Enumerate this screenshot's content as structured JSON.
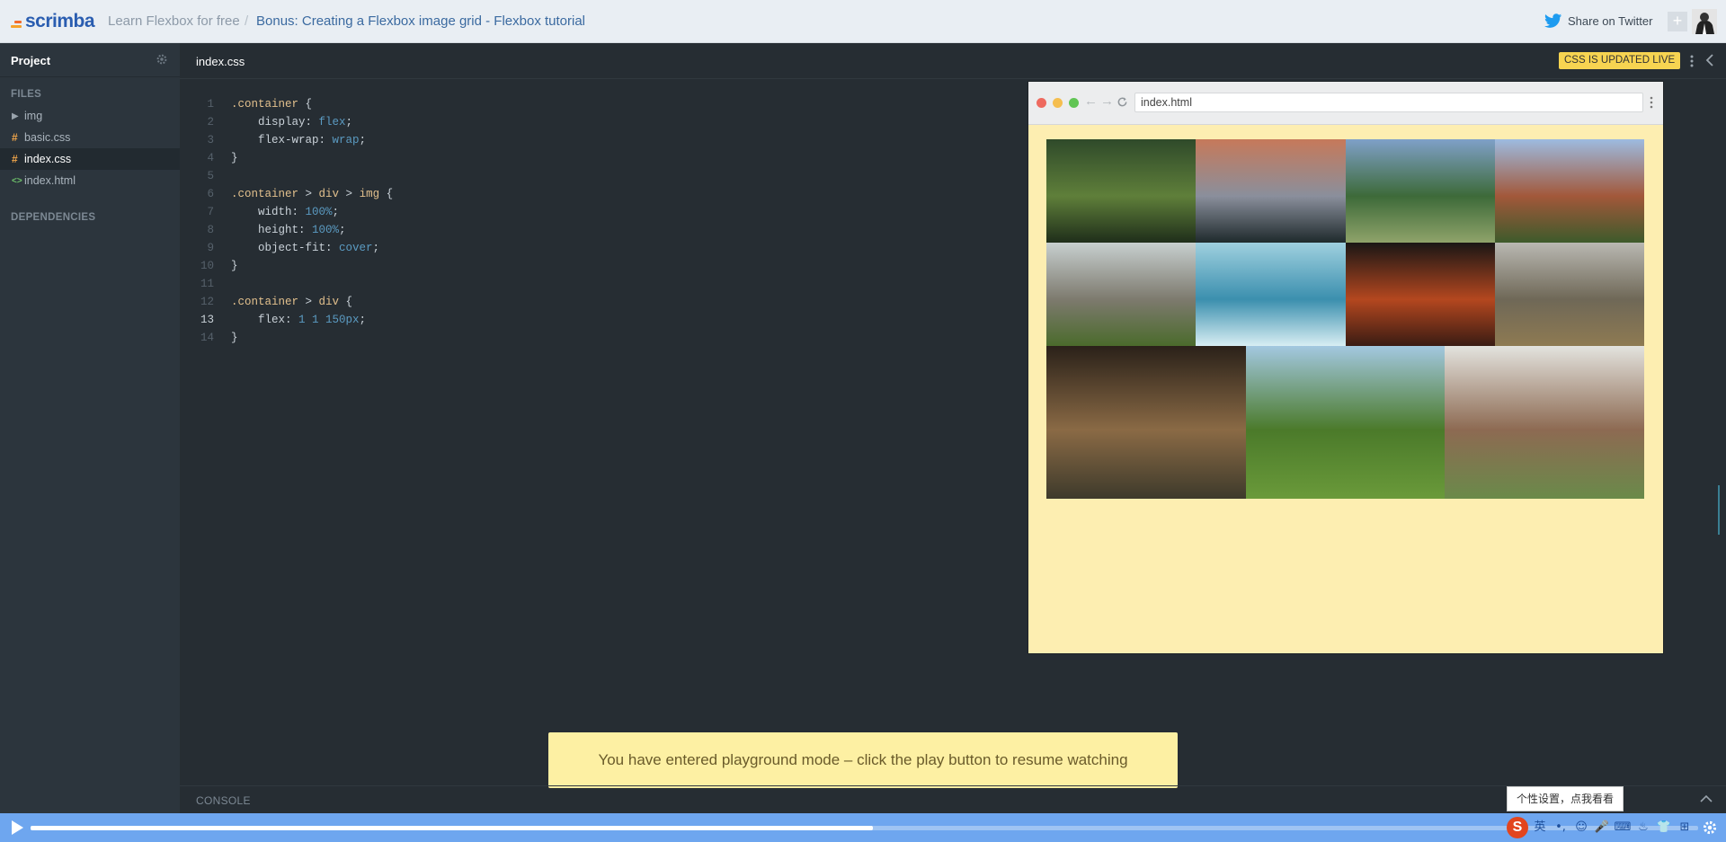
{
  "header": {
    "logo_text": "scrimba",
    "breadcrumb_course": "Learn Flexbox for free",
    "breadcrumb_separator": "/",
    "breadcrumb_lesson": "Bonus: Creating a Flexbox image grid - Flexbox tutorial",
    "share_label": "Share on Twitter",
    "add_label": "+",
    "icons": [
      "twitter-icon",
      "avatar"
    ]
  },
  "sidebar": {
    "title": "Project",
    "files_label": "FILES",
    "files": [
      {
        "label": "img",
        "glyph": "▶",
        "kind": "folder"
      },
      {
        "label": "basic.css",
        "glyph": "#",
        "kind": "css"
      },
      {
        "label": "index.css",
        "glyph": "#",
        "kind": "css",
        "active": true
      },
      {
        "label": "index.html",
        "glyph": "<>",
        "kind": "html"
      }
    ],
    "dependencies_label": "DEPENDENCIES"
  },
  "editor": {
    "tab": "index.css",
    "live_badge": "CSS IS UPDATED LIVE",
    "current_line": 13,
    "lines": [
      [
        {
          "t": ".container",
          "c": "sel"
        },
        {
          "t": " {",
          "c": "pun"
        }
      ],
      [
        {
          "t": "    display: ",
          "c": "prop"
        },
        {
          "t": "flex",
          "c": "val"
        },
        {
          "t": ";",
          "c": "pun"
        }
      ],
      [
        {
          "t": "    flex-wrap: ",
          "c": "prop"
        },
        {
          "t": "wrap",
          "c": "val"
        },
        {
          "t": ";",
          "c": "pun"
        }
      ],
      [
        {
          "t": "}",
          "c": "pun"
        }
      ],
      [],
      [
        {
          "t": ".container",
          "c": "sel"
        },
        {
          "t": " > ",
          "c": "pun"
        },
        {
          "t": "div",
          "c": "sel"
        },
        {
          "t": " > ",
          "c": "pun"
        },
        {
          "t": "img",
          "c": "sel"
        },
        {
          "t": " {",
          "c": "pun"
        }
      ],
      [
        {
          "t": "    width: ",
          "c": "prop"
        },
        {
          "t": "100%",
          "c": "val"
        },
        {
          "t": ";",
          "c": "pun"
        }
      ],
      [
        {
          "t": "    height: ",
          "c": "prop"
        },
        {
          "t": "100%",
          "c": "val"
        },
        {
          "t": ";",
          "c": "pun"
        }
      ],
      [
        {
          "t": "    object-fit: ",
          "c": "prop"
        },
        {
          "t": "cover",
          "c": "val"
        },
        {
          "t": ";",
          "c": "pun"
        }
      ],
      [
        {
          "t": "}",
          "c": "pun"
        }
      ],
      [],
      [
        {
          "t": ".container",
          "c": "sel"
        },
        {
          "t": " > ",
          "c": "pun"
        },
        {
          "t": "div",
          "c": "sel"
        },
        {
          "t": " {",
          "c": "pun"
        }
      ],
      [
        {
          "t": "    flex: ",
          "c": "prop"
        },
        {
          "t": "1 1 150px",
          "c": "val"
        },
        {
          "t": ";",
          "c": "pun"
        }
      ],
      [
        {
          "t": "}",
          "c": "pun"
        }
      ]
    ]
  },
  "preview": {
    "url": "index.html",
    "images": [
      {
        "name": "moss-forest-photo",
        "colors": [
          "#2f4a2a",
          "#5f7f3a",
          "#1f2e1a"
        ]
      },
      {
        "name": "snowy-mountain-photo",
        "colors": [
          "#c6795a",
          "#8a8f9c",
          "#1f2a2c"
        ]
      },
      {
        "name": "waterfall-lake-photo",
        "colors": [
          "#7fa0c8",
          "#3d6a39",
          "#8fa36a"
        ]
      },
      {
        "name": "red-cliff-photo",
        "colors": [
          "#9dbbe0",
          "#a2583a",
          "#3d5a2b"
        ]
      },
      {
        "name": "boulders-field-photo",
        "colors": [
          "#c7cfcf",
          "#7d7a6e",
          "#4b6b2c"
        ]
      },
      {
        "name": "glacier-ice-photo",
        "colors": [
          "#9fd0df",
          "#3b8fae",
          "#d8eef3"
        ]
      },
      {
        "name": "red-rock-night-photo",
        "colors": [
          "#1a1615",
          "#b4471f",
          "#3a1c13"
        ]
      },
      {
        "name": "misty-hills-photo",
        "colors": [
          "#b9b8b2",
          "#6f6857",
          "#8e7a52"
        ]
      },
      {
        "name": "pine-forest-path-photo",
        "colors": [
          "#2a2119",
          "#8a6a45",
          "#3e3a2b"
        ]
      },
      {
        "name": "lone-tree-photo",
        "colors": [
          "#a3c8e0",
          "#4b7a2a",
          "#6a9a3a"
        ]
      },
      {
        "name": "plowed-field-photo",
        "colors": [
          "#e3e3de",
          "#8d6a52",
          "#6a8a4a"
        ]
      }
    ]
  },
  "toast": "You have entered playground mode – click the play button to resume watching",
  "console": {
    "label": "CONSOLE"
  },
  "player": {
    "progress": 0.505
  },
  "ime": {
    "tooltip": "个性设置，点我看看",
    "cells": [
      "英",
      "•,",
      "☺",
      "🎤",
      "⌨",
      "♨",
      "👕",
      "⊞"
    ]
  },
  "colors": {
    "accent": "#f7d451",
    "brand": "#2a5db0",
    "player": "#6ea6ef"
  }
}
